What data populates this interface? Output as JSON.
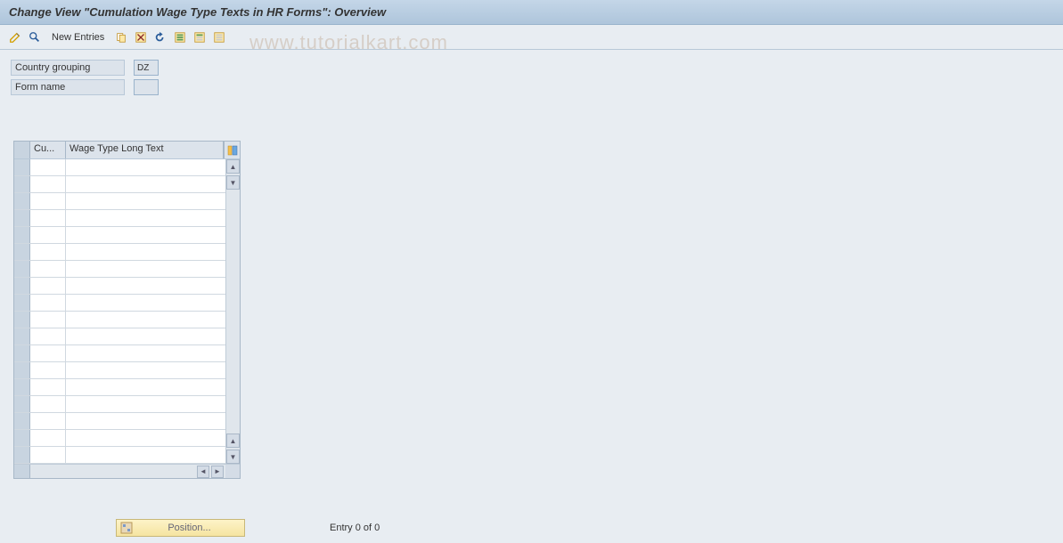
{
  "title": "Change View \"Cumulation Wage Type Texts in HR Forms\": Overview",
  "toolbar": {
    "new_entries": "New Entries"
  },
  "watermark": "www.tutorialkart.com",
  "form": {
    "country_grouping_label": "Country grouping",
    "country_grouping_value": "DZ",
    "form_name_label": "Form name",
    "form_name_value": ""
  },
  "table": {
    "col1": "Cu...",
    "col2": "Wage Type Long Text",
    "row_count": 18
  },
  "footer": {
    "position_label": "Position...",
    "entry_text": "Entry 0 of 0"
  }
}
